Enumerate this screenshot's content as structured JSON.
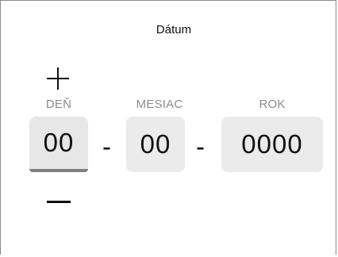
{
  "title": "Dátum",
  "labels": {
    "day": "DEŇ",
    "month": "MESIAC",
    "year": "ROK"
  },
  "values": {
    "day": "00",
    "month": "00",
    "year": "0000"
  },
  "separator": "-",
  "icons": {
    "increment": "plus-icon",
    "decrement": "minus-icon"
  },
  "colors": {
    "field_bg": "#ebebeb",
    "label_text": "#8c8c8c",
    "active_underline": "#7f7f7f"
  }
}
